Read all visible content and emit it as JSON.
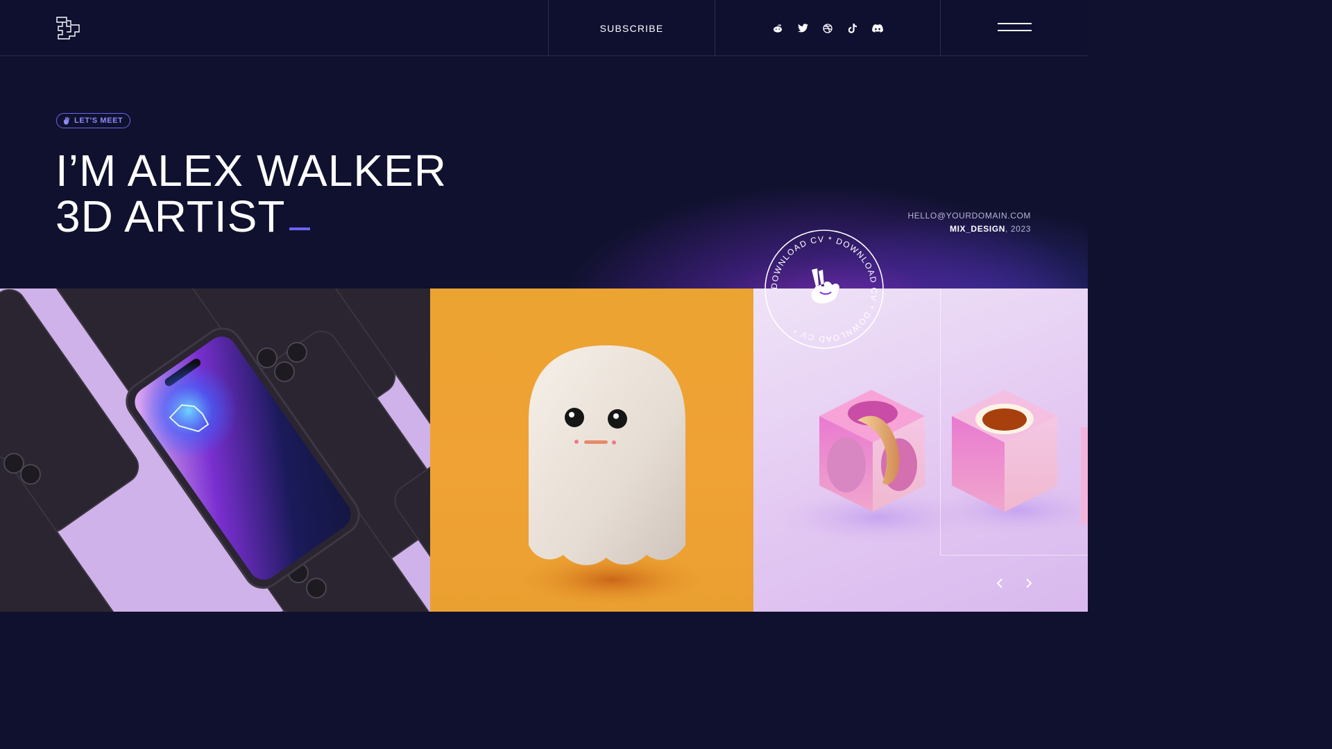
{
  "header": {
    "logo_icon": "cube-logo-icon",
    "subscribe_label": "SUBSCRIBE",
    "social_icons": [
      "reddit-icon",
      "twitter-icon",
      "dribbble-icon",
      "tiktok-icon",
      "discord-icon"
    ],
    "menu_icon": "hamburger-menu-icon"
  },
  "hero": {
    "badge_label": "LET'S MEET",
    "badge_icon": "hand-icon",
    "title_line1": "I’M ALEX WALKER",
    "title_line2": "3D ARTIST",
    "email": "HELLO@YOURDOMAIN.COM",
    "credit_name": "MIX_DESIGN",
    "credit_year": ", 2023"
  },
  "stamp": {
    "text": "DOWNLOAD CV * DOWNLOAD CV * DOWNLOAD CV * ",
    "icon": "peace-hand-icon"
  },
  "gallery": {
    "panels": [
      "phones-render",
      "ghost-render",
      "cubes-render"
    ],
    "prev_icon": "chevron-left-icon",
    "next_icon": "chevron-right-icon"
  },
  "colors": {
    "background": "#10112e",
    "accent": "#6c63ff",
    "border": "#2b2d52"
  }
}
